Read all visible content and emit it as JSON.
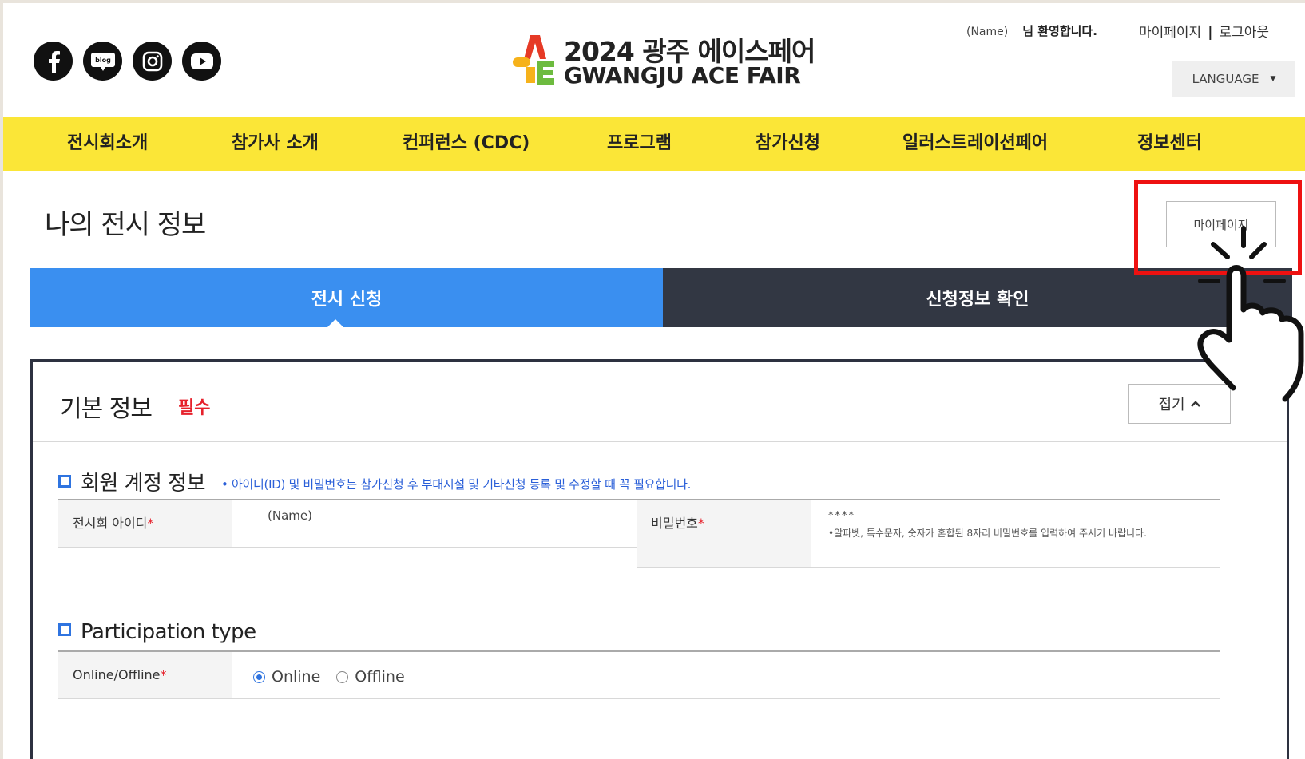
{
  "header": {
    "social": [
      {
        "icon": "facebook-icon",
        "glyph": "f"
      },
      {
        "icon": "blog-icon",
        "glyph": "blog"
      },
      {
        "icon": "instagram-icon",
        "glyph": ""
      },
      {
        "icon": "youtube-icon",
        "glyph": ""
      }
    ],
    "logo_line1": "2024 광주 에이스페어",
    "logo_line2": "GWANGJU ACE FAIR",
    "user_name": "(Name)",
    "welcome": "님 환영합니다.",
    "mypage_link": "마이페이지",
    "separator": "|",
    "logout_link": "로그아웃",
    "language_label": "LANGUAGE"
  },
  "nav": [
    "전시회소개",
    "참가사 소개",
    "컨퍼런스 (CDC)",
    "프로그램",
    "참가신청",
    "일러스트레이션페어",
    "정보센터"
  ],
  "page": {
    "title": "나의 전시 정보",
    "mypage_button": "마이페이지"
  },
  "tabs": {
    "active": "전시 신청",
    "inactive": "신청정보 확인"
  },
  "form": {
    "section_title": "기본 정보",
    "required_label": "필수",
    "fold_button": "접기",
    "account": {
      "title": "회원 계정 정보",
      "note": "• 아이디(ID) 및 비밀번호는 참가신청 후 부대시설 및 기타신청 등록 및 수정할 때 꼭 필요합니다.",
      "id_label": "전시회 아이디",
      "id_value": "(Name)",
      "password_label": "비밀번호",
      "password_value": "****",
      "password_help": "•알파벳, 특수문자, 숫자가 혼합된 8자리 비밀번호를 입력하여 주시기 바랍니다."
    },
    "participation": {
      "title": "Participation type",
      "label": "Online/Offline",
      "options": [
        "Online",
        "Offline"
      ],
      "selected": "Online"
    },
    "required_mark": "*"
  },
  "colors": {
    "nav_bg": "#fbe637",
    "tab_active": "#3a8ff0",
    "tab_inactive": "#323743",
    "required": "#e6212c",
    "note_blue": "#2a5fd8",
    "highlight": "#ee1111"
  }
}
